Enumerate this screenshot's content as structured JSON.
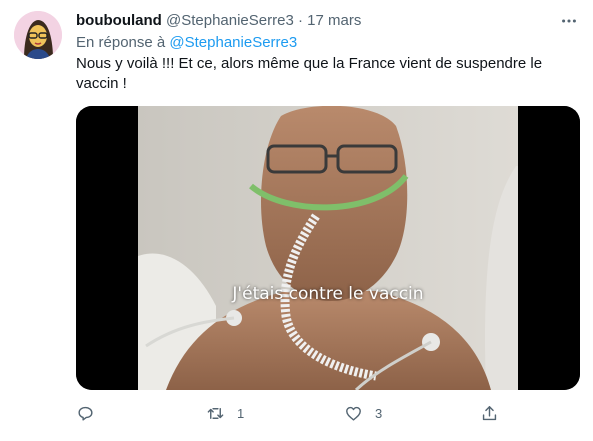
{
  "tweet": {
    "author_name": "boubouland",
    "author_handle": "@StephanieSerre3",
    "separator": "·",
    "date": "17 mars",
    "reply_prefix": "En réponse à",
    "reply_to": "@StephanieSerre3",
    "text": "Nous y voilà !!! Et ce, alors même que la France vient de suspendre le vaccin !",
    "media_subtitle": "J'étais contre le vaccin",
    "actions": {
      "reply_icon": "comment-icon",
      "retweet_icon": "retweet-icon",
      "retweet_count": "1",
      "like_icon": "heart-icon",
      "like_count": "3",
      "share_icon": "share-icon"
    }
  },
  "colors": {
    "link": "#1d9bf0",
    "secondary_text": "#536471",
    "primary_text": "#0f1419"
  }
}
